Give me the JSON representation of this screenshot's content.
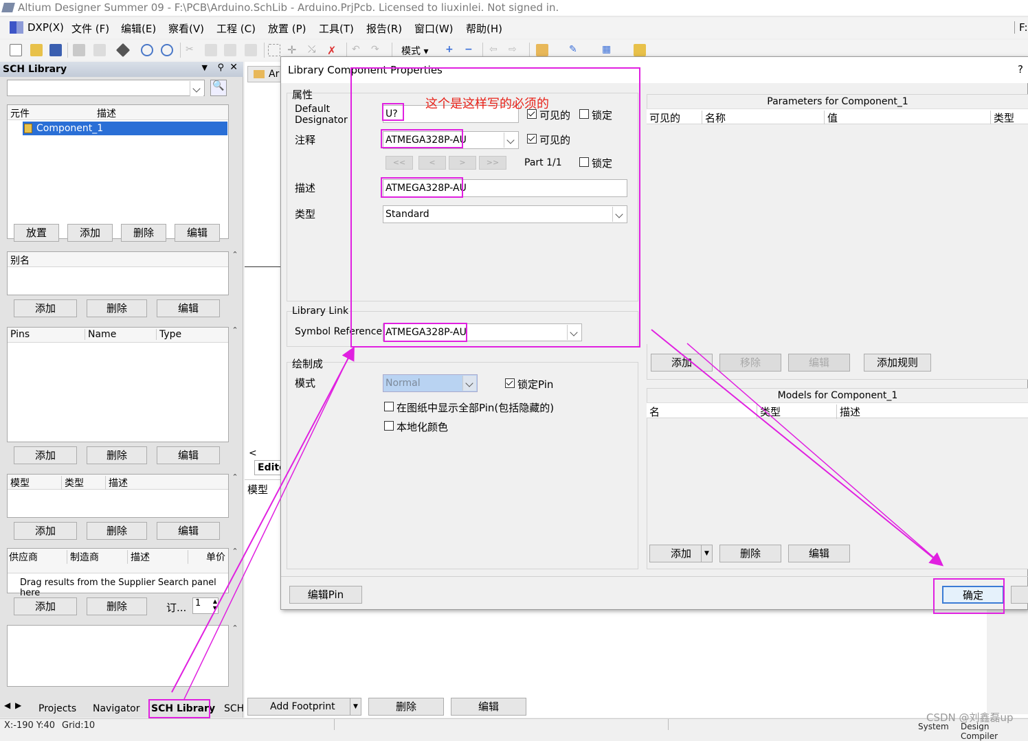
{
  "window": {
    "title": "Altium Designer Summer 09 - F:\\PCB\\Arduino.SchLib - Arduino.PrjPcb. Licensed to liuxinlei. Not signed in."
  },
  "menu": [
    "DXP(X)",
    "文件 (F)",
    "编辑(E)",
    "察看(V)",
    "工程 (C)",
    "放置 (P)",
    "工具(T)",
    "报告(R)",
    "窗口(W)",
    "帮助(H)"
  ],
  "menu_right": "F:",
  "toolbar": {
    "mode_label": "模式 ▾"
  },
  "sch_library": {
    "title": "SCH Library",
    "filter_value": "",
    "components_headers": [
      "元件",
      "描述"
    ],
    "components": [
      "Component_1"
    ],
    "component_buttons": [
      "放置",
      "添加",
      "删除",
      "编辑"
    ],
    "alias_header": "别名",
    "alias_buttons": [
      "添加",
      "删除",
      "编辑"
    ],
    "pins_headers": [
      "Pins",
      "Name",
      "Type"
    ],
    "pins_buttons": [
      "添加",
      "删除",
      "编辑"
    ],
    "models_headers": [
      "模型",
      "类型",
      "描述"
    ],
    "models_buttons": [
      "添加",
      "删除",
      "编辑"
    ],
    "supplier_headers": [
      "供应商",
      "制造商",
      "描述",
      "单价"
    ],
    "supplier_hint": "Drag results from the Supplier Search panel here",
    "supplier_buttons": [
      "添加",
      "删除"
    ],
    "order_label": "订...",
    "order_qty": "1"
  },
  "doc": {
    "tab_label": "Ar",
    "editor_tab": "Edito",
    "model_label": "模型",
    "bottom_buttons": [
      "Add Footprint",
      "删除",
      "编辑"
    ]
  },
  "dialog": {
    "title": "Library Component Properties",
    "help": "?",
    "annotation_note": "这个是这样写的必须的",
    "properties_group": "属性",
    "default_designator_label": "Default Designator",
    "designator_value": "U?",
    "visible_label": "可见的",
    "lock_label": "锁定",
    "comment_label": "注释",
    "comment_value": "ATMEGA328P-AU",
    "comment_visible_label": "可见的",
    "nav_buttons": [
      "<<",
      "<",
      ">",
      ">>"
    ],
    "part_label": "Part 1/1",
    "part_lock_label": "锁定",
    "description_label": "描述",
    "description_value": "ATMEGA328P-AU",
    "type_label": "类型",
    "type_value": "Standard",
    "library_link_group": "Library Link",
    "symbol_reference_label": "Symbol Reference",
    "symbol_reference_value": "ATMEGA328P-AU",
    "graphical_group": "绘制成",
    "mode_label": "模式",
    "mode_value": "Normal",
    "lock_pins_label": "锁定Pin",
    "show_all_pins_label": "在图纸中显示全部Pin(包括隐藏的)",
    "local_colors_label": "本地化颜色",
    "params_title": "Parameters for Component_1",
    "params_headers": [
      "可见的",
      "名称",
      "值",
      "类型"
    ],
    "params_buttons": [
      "添加",
      "移除",
      "编辑",
      "添加规则"
    ],
    "models_title": "Models for Component_1",
    "models_headers": [
      "名",
      "类型",
      "描述"
    ],
    "models_buttons": [
      "添加",
      "删除",
      "编辑"
    ],
    "edit_pins_button": "编辑Pin",
    "ok_button": "确定"
  },
  "panel_tabs": [
    "Projects",
    "Navigator",
    "SCH Library",
    "SCH"
  ],
  "status": {
    "coords": "X:-190 Y:40",
    "grid": "Grid:10",
    "right_items": [
      "System",
      "Design Compiler"
    ]
  },
  "watermark": "CSDN @刘鑫磊up"
}
